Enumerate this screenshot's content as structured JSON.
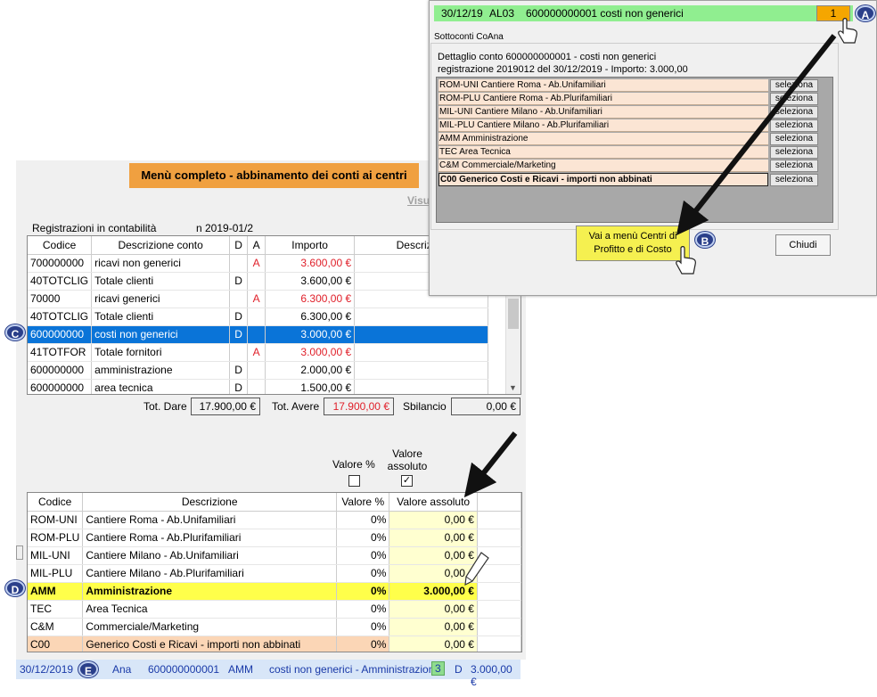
{
  "main": {
    "title": "Menù completo - abbinamento dei conti ai centri",
    "visual_link": "Visua",
    "reg_label": "Registrazioni in contabilità",
    "reg_number": "n 2019-01/2",
    "top_table": {
      "headers": [
        "Codice",
        "Descrizione conto",
        "D",
        "A",
        "Importo",
        "Descrizion"
      ],
      "rows": [
        {
          "code": "700000000",
          "desc": "ricavi non generici",
          "d": "",
          "a": "A",
          "amount": "3.600,00 €",
          "red": true
        },
        {
          "code": "40TOTCLIG",
          "desc": "Totale clienti",
          "d": "D",
          "a": "",
          "amount": "3.600,00 €",
          "red": false
        },
        {
          "code": "70000",
          "desc": "ricavi generici",
          "d": "",
          "a": "A",
          "amount": "6.300,00 €",
          "red": true
        },
        {
          "code": "40TOTCLIG",
          "desc": "Totale clienti",
          "d": "D",
          "a": "",
          "amount": "6.300,00 €",
          "red": false
        },
        {
          "code": "600000000",
          "desc": "costi non generici",
          "d": "D",
          "a": "",
          "amount": "3.000,00 €",
          "red": false,
          "selected": true
        },
        {
          "code": "41TOTFOR",
          "desc": "Totale fornitori",
          "d": "",
          "a": "A",
          "amount": "3.000,00 €",
          "red": true
        },
        {
          "code": "600000000",
          "desc": "amministrazione",
          "d": "D",
          "a": "",
          "amount": "2.000,00 €",
          "red": false
        },
        {
          "code": "600000000",
          "desc": "area tecnica",
          "d": "D",
          "a": "",
          "amount": "1.500,00 €",
          "red": false
        }
      ]
    },
    "totals": {
      "dare_label": "Tot. Dare",
      "dare": "17.900,00 €",
      "avere_label": "Tot. Avere",
      "avere": "17.900,00 €",
      "sbilancio_label": "Sbilancio",
      "sbilancio": "0,00 €"
    },
    "options": {
      "pct_label": "Valore %",
      "abs_label": "Valore assoluto",
      "pct_checked": false,
      "abs_checked": true
    },
    "bottom_table": {
      "headers": [
        "Codice",
        "Descrizione",
        "Valore %",
        "Valore assoluto"
      ],
      "rows": [
        {
          "code": "ROM-UNI",
          "desc": "Cantiere Roma - Ab.Unifamiliari",
          "pct": "0%",
          "abs": "0,00 €"
        },
        {
          "code": "ROM-PLU",
          "desc": "Cantiere Roma - Ab.Plurifamiliari",
          "pct": "0%",
          "abs": "0,00 €"
        },
        {
          "code": "MIL-UNI",
          "desc": "Cantiere Milano - Ab.Unifamiliari",
          "pct": "0%",
          "abs": "0,00 €"
        },
        {
          "code": "MIL-PLU",
          "desc": "Cantiere Milano - Ab.Plurifamiliari",
          "pct": "0%",
          "abs": "0,00 €"
        },
        {
          "code": "AMM",
          "desc": "Amministrazione",
          "pct": "0%",
          "abs": "3.000,00 €",
          "highlight": true
        },
        {
          "code": "TEC",
          "desc": "Area Tecnica",
          "pct": "0%",
          "abs": "0,00 €"
        },
        {
          "code": "C&M",
          "desc": "Commerciale/Marketing",
          "pct": "0%",
          "abs": "0,00 €"
        },
        {
          "code": "C00",
          "desc": "Generico Costi e Ricavi - importi non abbinati",
          "pct": "0%",
          "abs": "0,00 €",
          "peach": true
        }
      ]
    }
  },
  "status_bar": {
    "date": "30/12/2019",
    "type": "Ana",
    "account": "600000000001",
    "center": "AMM",
    "desc": "costi non generici - Amministrazione",
    "count": "3",
    "side": "D",
    "amount": "3.000,00 €"
  },
  "popup": {
    "top_date": "30/12/19",
    "top_code": "AL03",
    "top_desc": "600000000001 costi non generici",
    "top_count": "1",
    "section_label": "Sottoconti CoAna",
    "detail_line1": "Dettaglio conto 600000000001 - costi non generici",
    "detail_line2": "registrazione 2019012 del 30/12/2019 - Importo: 3.000,00",
    "sub_rows": [
      {
        "label": "ROM-UNI Cantiere Roma - Ab.Unifamiliari",
        "btn": "seleziona"
      },
      {
        "label": "ROM-PLU Cantiere Roma - Ab.Plurifamiliari",
        "btn": "seleziona"
      },
      {
        "label": "MIL-UNI Cantiere Milano - Ab.Unifamiliari",
        "btn": "seleziona"
      },
      {
        "label": "MIL-PLU Cantiere Milano - Ab.Plurifamiliari",
        "btn": "seleziona"
      },
      {
        "label": "AMM Amministrazione",
        "btn": "seleziona"
      },
      {
        "label": "TEC Area Tecnica",
        "btn": "seleziona"
      },
      {
        "label": "C&M Commerciale/Marketing",
        "btn": "seleziona"
      },
      {
        "label": "C00 Generico Costi e Ricavi - importi non abbinati",
        "btn": "seleziona",
        "bold": true
      }
    ],
    "vai_label_1": "Vai a menù Centri di",
    "vai_label_2": "Profitto e di Costo",
    "chiudi_label": "Chiudi"
  },
  "callouts": {
    "a": "A",
    "b": "B",
    "c": "C",
    "d": "D",
    "e": "E"
  },
  "icons": [
    "hand-pointer-icon",
    "pencil-icon",
    "arrow-icon",
    "checkbox-icon",
    "scroll-down-icon"
  ],
  "colors": {
    "accent_orange": "#f0a040",
    "selected_blue": "#0a74d8",
    "highlight_yellow": "#ffff4a",
    "red_amount": "#e0202a"
  }
}
